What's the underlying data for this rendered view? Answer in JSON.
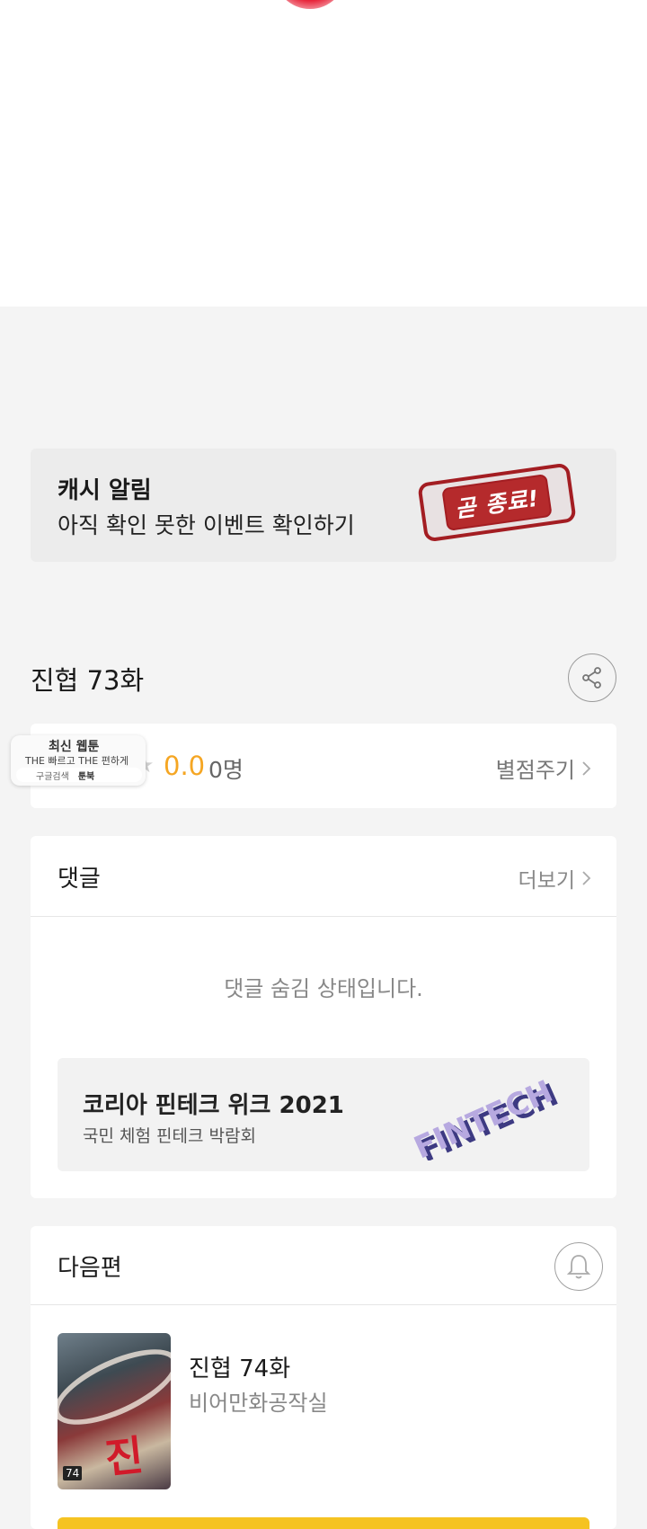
{
  "cash_banner": {
    "title": "캐시 알림",
    "subtitle": "아직 확인 못한 이벤트 확인하기",
    "stamp_text": "곧 종료!"
  },
  "episode": {
    "title": "진협 73화",
    "share_icon": "share-icon"
  },
  "rating": {
    "star": "★",
    "value": "0.0",
    "count": "0명",
    "rate_label": "별점주기"
  },
  "ad_badge": {
    "line1": "최신 웹툰",
    "line2": "THE 빠르고 THE 편하게",
    "search_label": "구글검색",
    "toonbook_label": "툰북"
  },
  "comments": {
    "title": "댓글",
    "more_label": "더보기",
    "hidden_message": "댓글 숨김 상태입니다."
  },
  "fintech_banner": {
    "title": "코리아 핀테크 위크 2021",
    "subtitle": "국민 체험 핀테크 박람회",
    "logo_text": "FINTECH"
  },
  "next_episode": {
    "header": "다음편",
    "bell_icon": "bell-icon",
    "title": "진협 74화",
    "author": "비어만화공작실",
    "thumb_title": "진협",
    "thumb_num": "74"
  },
  "colors": {
    "rating": "#f5a623",
    "stamp": "#a31d22",
    "button": "#f5c322",
    "background": "#f4f4f4"
  }
}
